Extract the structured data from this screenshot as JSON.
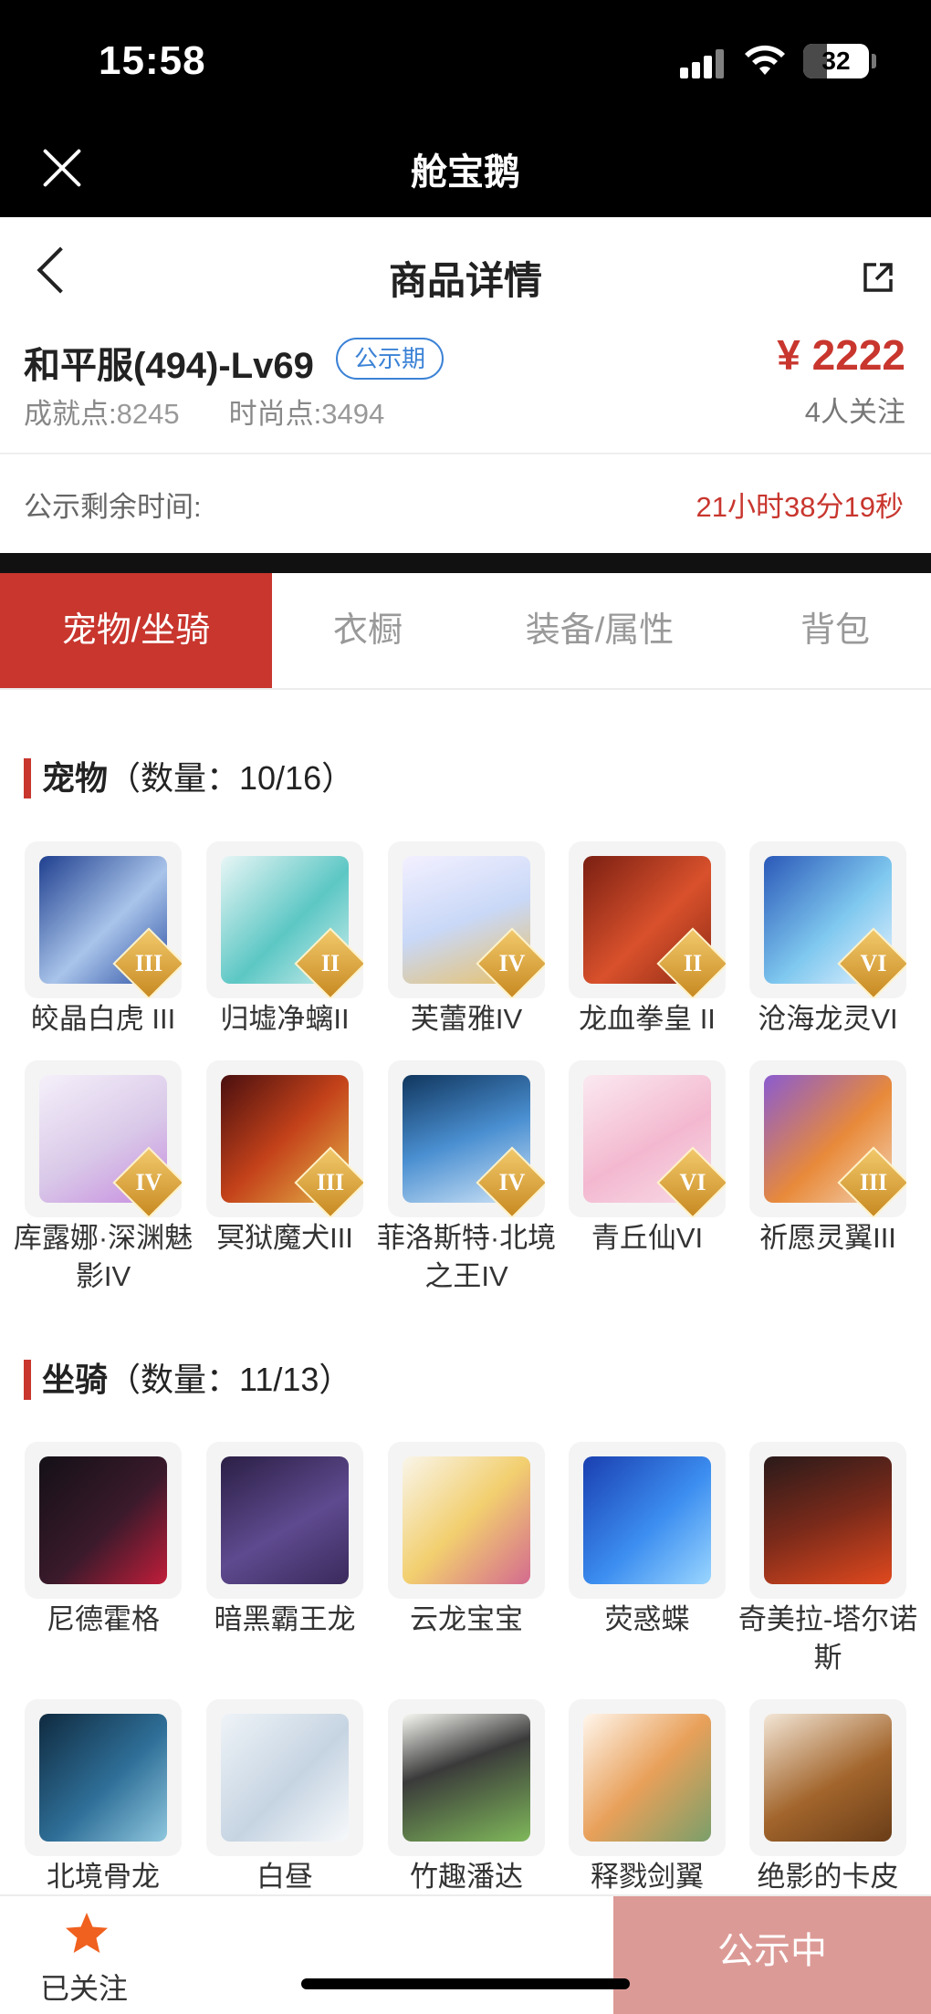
{
  "status_bar": {
    "time": "15:58",
    "battery": "32"
  },
  "app_bar": {
    "title": "舱宝鹅"
  },
  "nav": {
    "title": "商品详情"
  },
  "product": {
    "server": "和平服(494)-Lv69",
    "badge": "公示期",
    "achievement_label": "成就点:",
    "achievement_value": "8245",
    "fashion_label": "时尚点:",
    "fashion_value": "3494",
    "price": "¥ 2222",
    "followers": "4人关注"
  },
  "countdown": {
    "label": "公示剩余时间:",
    "value": "21小时38分19秒"
  },
  "tabs": [
    {
      "label": "宠物/坐骑",
      "active": true
    },
    {
      "label": "衣橱",
      "active": false
    },
    {
      "label": "装备/属性",
      "active": false
    },
    {
      "label": "背包",
      "active": false
    }
  ],
  "pets": {
    "title": "宠物",
    "count": "（数量：10/16）",
    "items": [
      {
        "name": "皎晶白虎 III",
        "tier": "III"
      },
      {
        "name": "归墟净螭II",
        "tier": "II"
      },
      {
        "name": "芙蕾雅IV",
        "tier": "IV"
      },
      {
        "name": "龙血拳皇 II",
        "tier": "II"
      },
      {
        "name": "沧海龙灵VI",
        "tier": "VI"
      },
      {
        "name": "库露娜·深渊魅影IV",
        "tier": "IV"
      },
      {
        "name": "冥狱魔犬III",
        "tier": "III"
      },
      {
        "name": "菲洛斯特·北境之王IV",
        "tier": "IV"
      },
      {
        "name": "青丘仙VI",
        "tier": "VI"
      },
      {
        "name": "祈愿灵翼III",
        "tier": "III"
      }
    ]
  },
  "mounts": {
    "title": "坐骑",
    "count": "（数量：11/13）",
    "items": [
      {
        "name": "尼德霍格"
      },
      {
        "name": "暗黑霸王龙"
      },
      {
        "name": "云龙宝宝"
      },
      {
        "name": "荧惑蝶"
      },
      {
        "name": "奇美拉-塔尔诺斯"
      },
      {
        "name": "北境骨龙"
      },
      {
        "name": "白昼"
      },
      {
        "name": "竹趣潘达"
      },
      {
        "name": "释戮剑翼"
      },
      {
        "name": "绝影的卡皮"
      }
    ]
  },
  "bottom": {
    "follow_label": "已关注",
    "status_button": "公示中"
  },
  "colors": {
    "accent": "#c8362e",
    "badge": "#3b82d6",
    "status_button": "#dc9a96"
  }
}
